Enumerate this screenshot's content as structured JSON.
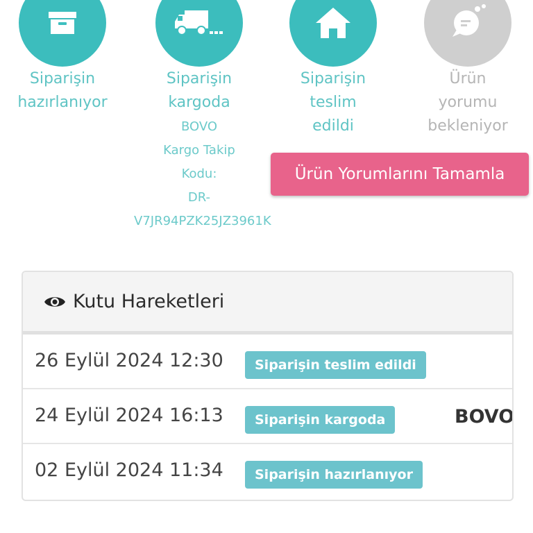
{
  "steps": [
    {
      "title_line1": "Siparişin",
      "title_line2": "hazırlanıyor",
      "icon": "box-icon",
      "state": "done"
    },
    {
      "title_line1": "Siparişin",
      "title_line2": "kargoda",
      "icon": "truck-icon",
      "state": "done",
      "cargo": {
        "line1": "BOVO",
        "line2": "Kargo Takip",
        "line3": "Kodu:",
        "line4": "DR-",
        "line5": "V7JR94PZK25JZ3961K"
      }
    },
    {
      "title_line1": "Siparişin",
      "title_line2": "teslim",
      "title_line3": "edildi",
      "icon": "home-icon",
      "state": "done"
    },
    {
      "title_line1": "Ürün",
      "title_line2": "yorumu",
      "title_line3": "bekleniyor",
      "icon": "comment-icon",
      "state": "pending"
    }
  ],
  "review_button_label": "Ürün Yorumlarını Tamamla",
  "panel": {
    "title": "Kutu Hareketleri",
    "icon": "eye-icon",
    "rows": [
      {
        "date": "26 Eylül 2024 12:30",
        "status": "Siparişin teslim edildi",
        "extra": ""
      },
      {
        "date": "24 Eylül 2024 16:13",
        "status": "Siparişin kargoda",
        "extra": "BOVO"
      },
      {
        "date": "02 Eylül 2024 11:34",
        "status": "Siparişin hazırlanıyor",
        "extra": ""
      }
    ]
  },
  "colors": {
    "teal": "#3dbfbf",
    "pink": "#e8638b",
    "badge": "#6cc3cc",
    "pending": "#cfcfcf"
  }
}
